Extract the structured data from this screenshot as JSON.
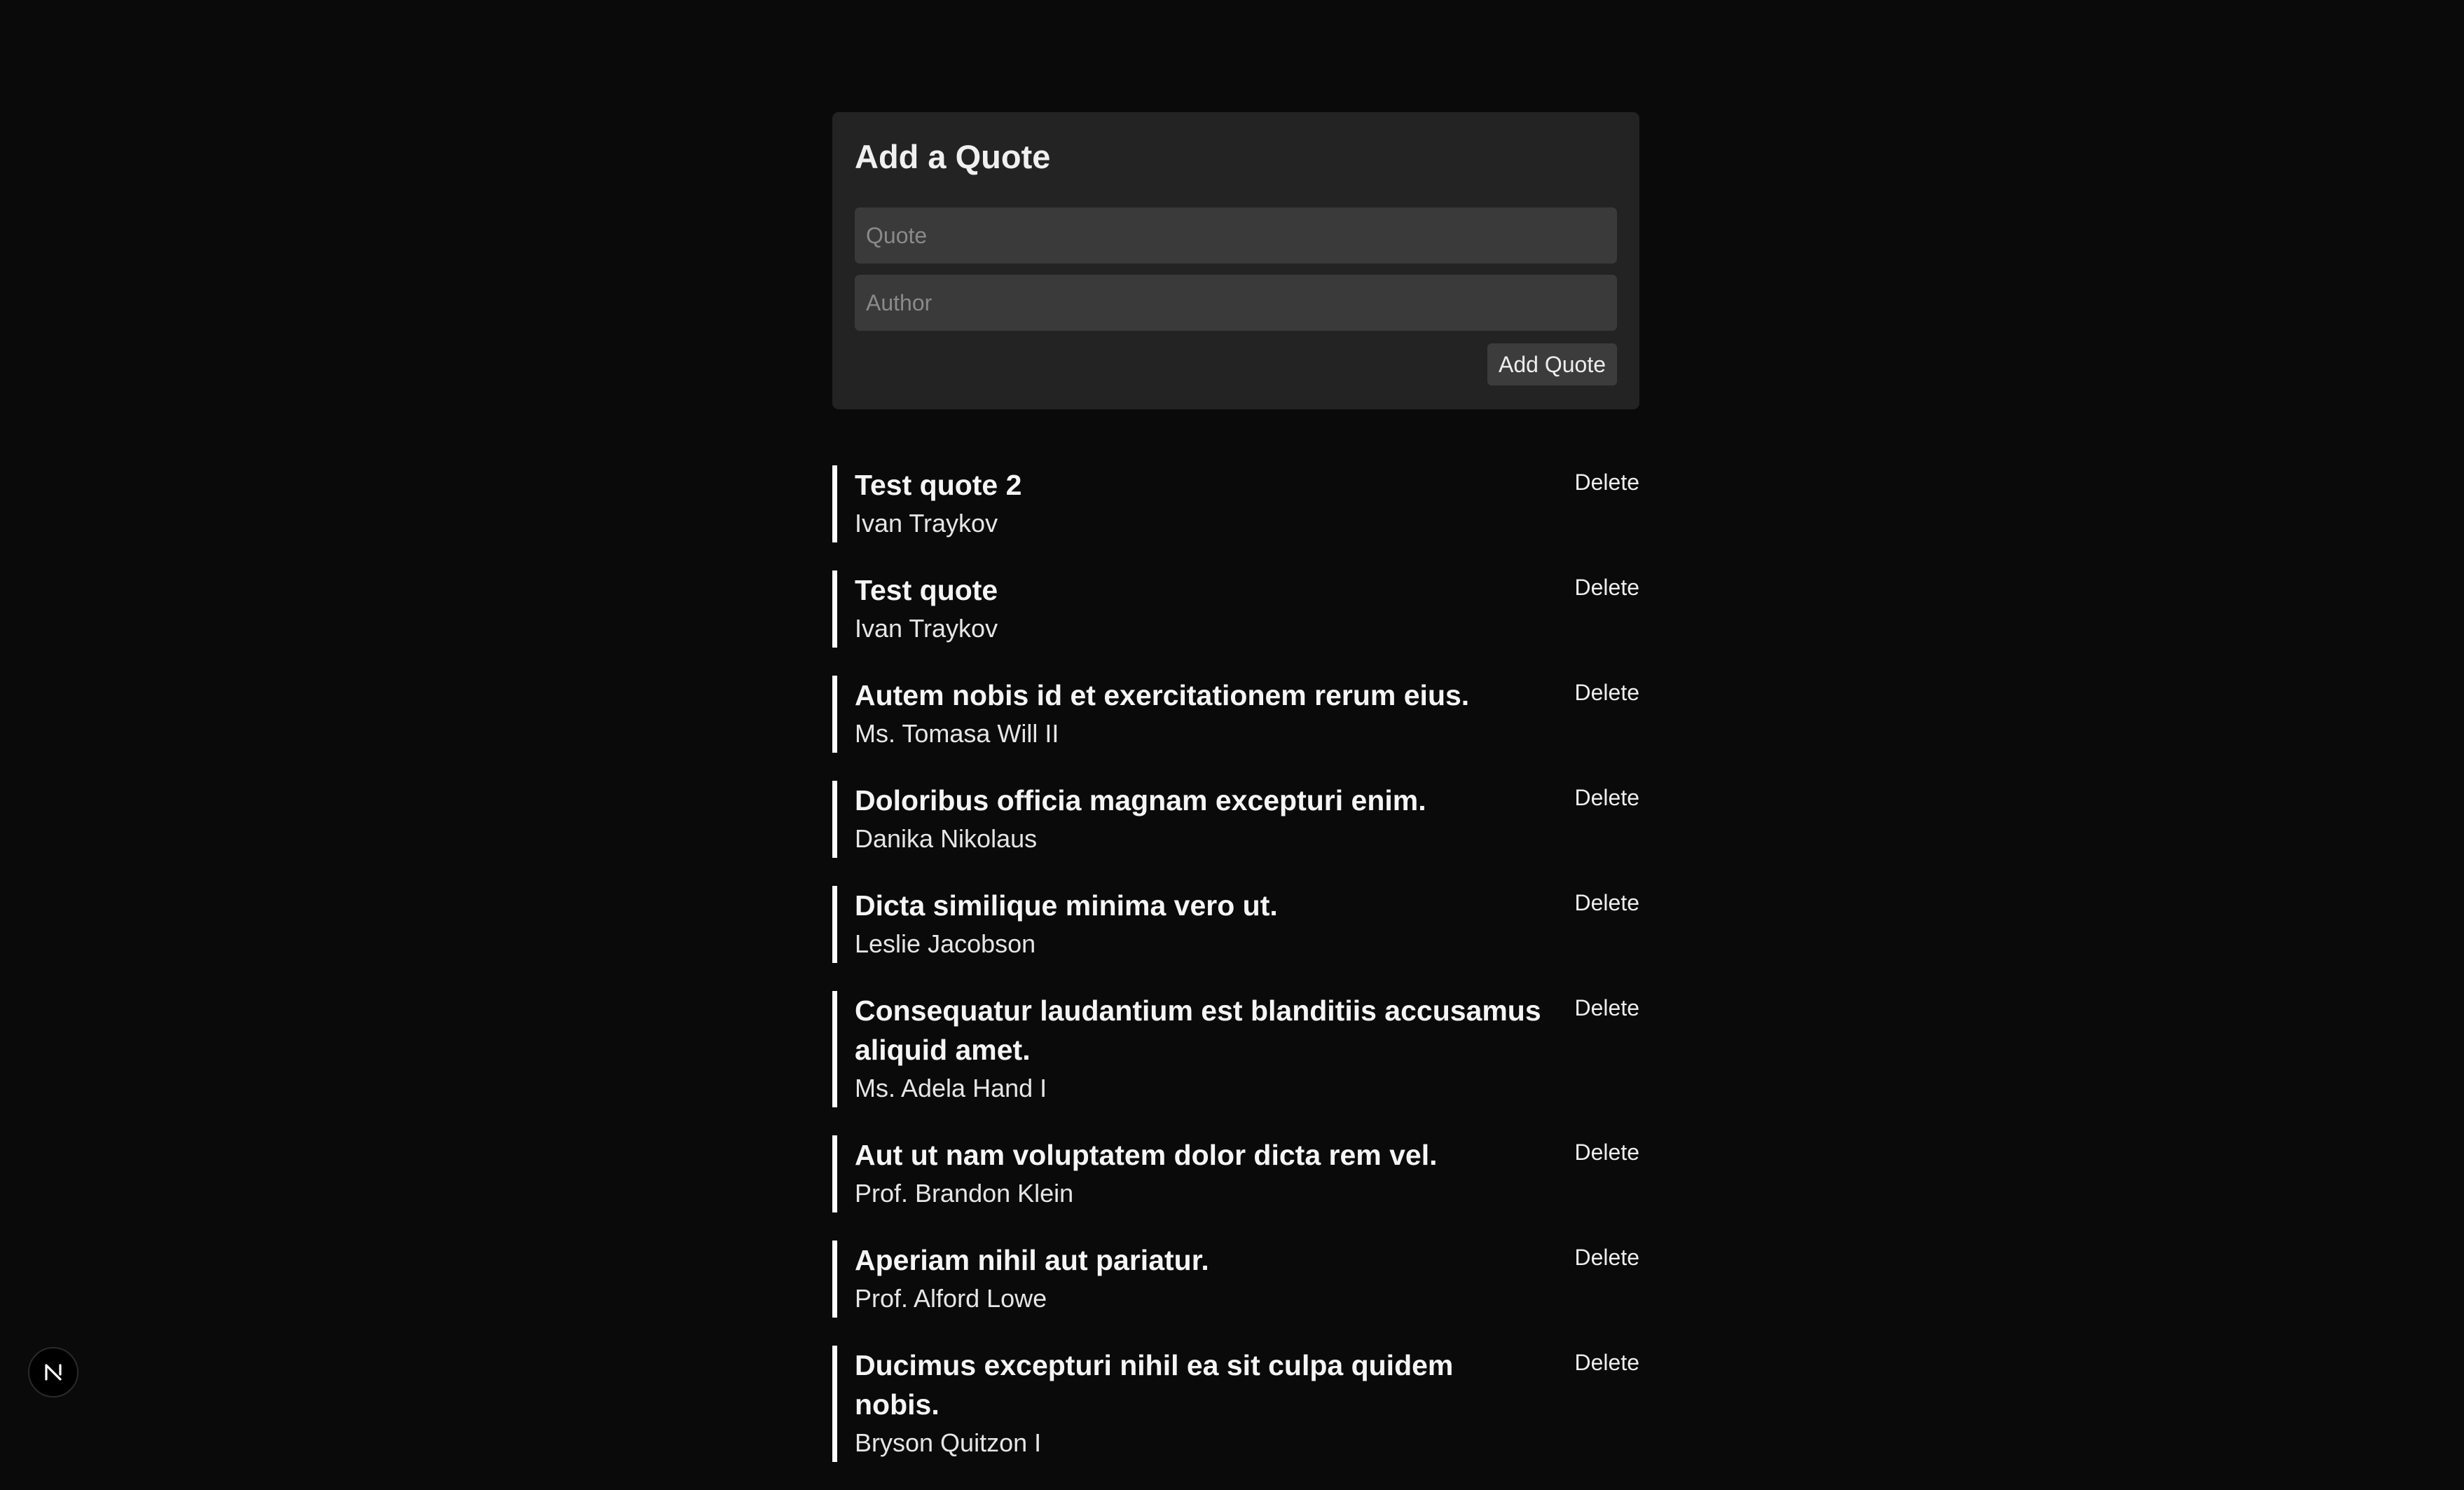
{
  "form": {
    "title": "Add a Quote",
    "quote_placeholder": "Quote",
    "author_placeholder": "Author",
    "quote_value": "",
    "author_value": "",
    "submit_label": "Add Quote"
  },
  "quotes": [
    {
      "text": "Test quote 2",
      "author": "Ivan Traykov",
      "delete_label": "Delete"
    },
    {
      "text": "Test quote",
      "author": "Ivan Traykov",
      "delete_label": "Delete"
    },
    {
      "text": "Autem nobis id et exercitationem rerum eius.",
      "author": "Ms. Tomasa Will II",
      "delete_label": "Delete"
    },
    {
      "text": "Doloribus officia magnam excepturi enim.",
      "author": "Danika Nikolaus",
      "delete_label": "Delete"
    },
    {
      "text": "Dicta similique minima vero ut.",
      "author": "Leslie Jacobson",
      "delete_label": "Delete"
    },
    {
      "text": "Consequatur laudantium est blanditiis accusamus aliquid amet.",
      "author": "Ms. Adela Hand I",
      "delete_label": "Delete"
    },
    {
      "text": "Aut ut nam voluptatem dolor dicta rem vel.",
      "author": "Prof. Brandon Klein",
      "delete_label": "Delete"
    },
    {
      "text": "Aperiam nihil aut pariatur.",
      "author": "Prof. Alford Lowe",
      "delete_label": "Delete"
    },
    {
      "text": "Ducimus excepturi nihil ea sit culpa quidem nobis.",
      "author": "Bryson Quitzon I",
      "delete_label": "Delete"
    }
  ],
  "dev_badge": {
    "icon": "nextjs-logo-icon",
    "glyph": "N"
  },
  "colors": {
    "background": "#0a0a0a",
    "card": "#232323",
    "input": "#3a3a3a",
    "accent_border": "#ffffff"
  }
}
